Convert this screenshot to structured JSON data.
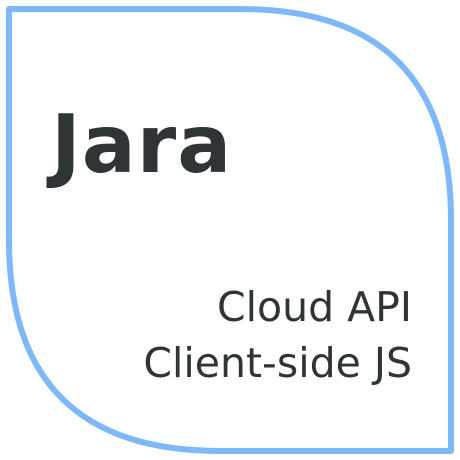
{
  "card": {
    "title": "Jara",
    "features": [
      "Cloud API",
      "Client-side JS"
    ]
  },
  "colors": {
    "border": "#7fb8f6",
    "background": "#ffffff",
    "text": "#2f3437"
  }
}
